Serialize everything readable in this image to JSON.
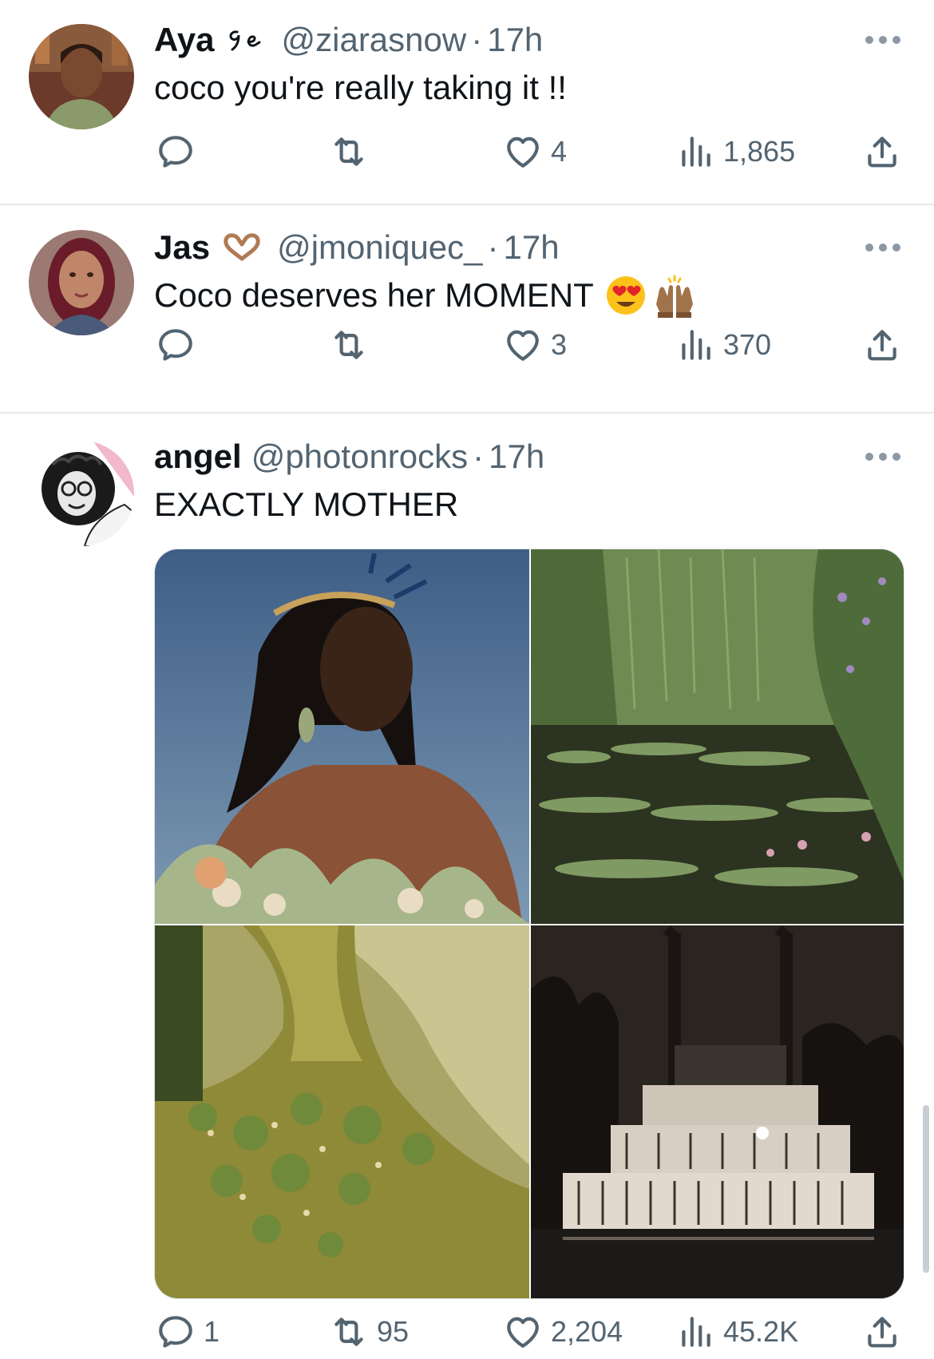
{
  "tweets": [
    {
      "display_name": "Aya",
      "name_emoji": "9e-script-icon",
      "handle": "@ziarasnow",
      "separator": "·",
      "time": "17h",
      "text": "coco you're really taking it !!",
      "replies": "",
      "retweets": "",
      "likes": "4",
      "views": "1,865"
    },
    {
      "display_name": "Jas",
      "name_emoji": "heart-hands-icon",
      "handle": "@jmoniquec_",
      "separator": "·",
      "time": "17h",
      "text": "Coco deserves her MOMENT",
      "text_emojis": [
        "heart-eyes-emoji-icon",
        "raising-hands-emoji-icon"
      ],
      "replies": "",
      "retweets": "",
      "likes": "3",
      "views": "370"
    },
    {
      "display_name": "angel",
      "handle": "@photonrocks",
      "separator": "·",
      "time": "17h",
      "text": "EXACTLY MOTHER",
      "media": [
        "portrait-photo",
        "lily-pond-photo",
        "gown-detail-photo",
        "riverboat-photo"
      ],
      "replies": "1",
      "retweets": "95",
      "likes": "2,204",
      "views": "45.2K"
    }
  ],
  "icons": {
    "reply": "reply-icon",
    "retweet": "retweet-icon",
    "like": "heart-icon",
    "views": "views-icon",
    "share": "share-icon",
    "more": "more-icon"
  },
  "colors": {
    "text": "#0f1419",
    "secondary": "#536471",
    "divider": "#e6e9eb"
  }
}
